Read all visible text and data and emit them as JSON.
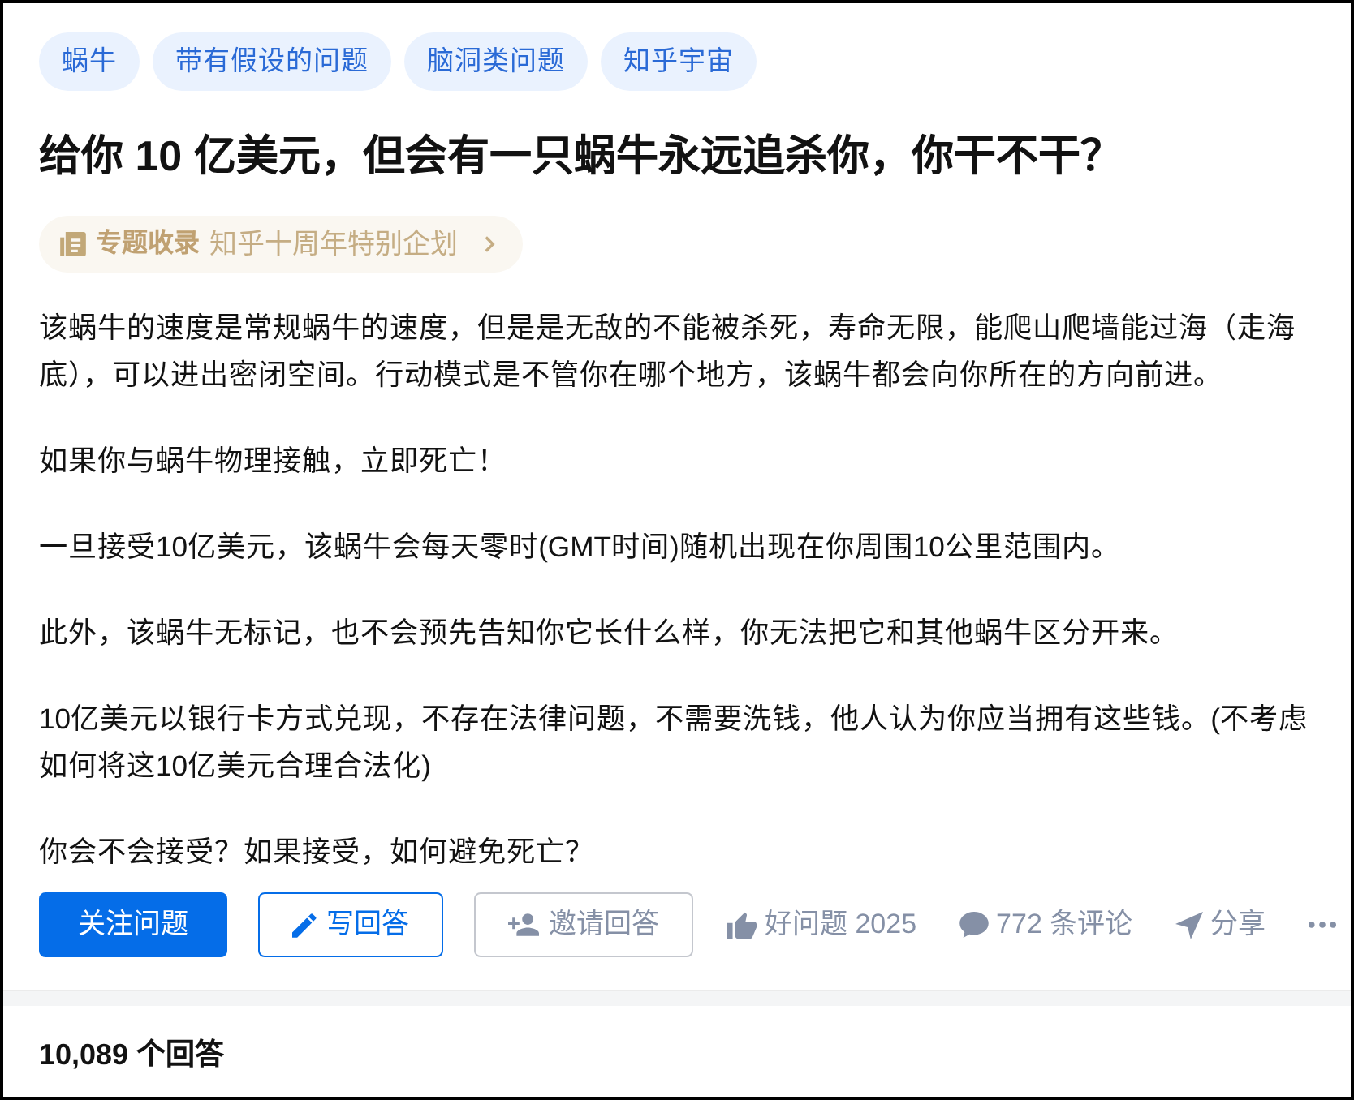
{
  "tags": [
    "蜗牛",
    "带有假设的问题",
    "脑洞类问题",
    "知乎宇宙"
  ],
  "title": "给你 10 亿美元，但会有一只蜗牛永远追杀你，你干不干？",
  "collection": {
    "label": "专题收录",
    "name": "知乎十周年特别企划"
  },
  "description": [
    "该蜗牛的速度是常规蜗牛的速度，但是是无敌的不能被杀死，寿命无限，能爬山爬墙能过海（走海底），可以进出密闭空间。行动模式是不管你在哪个地方，该蜗牛都会向你所在的方向前进。",
    "如果你与蜗牛物理接触，立即死亡！",
    "一旦接受10亿美元，该蜗牛会每天零时(GMT时间)随机出现在你周围10公里范围内。",
    "此外，该蜗牛无标记，也不会预先告知你它长什么样，你无法把它和其他蜗牛区分开来。",
    "10亿美元以银行卡方式兑现，不存在法律问题，不需要洗钱，他人认为你应当拥有这些钱。(不考虑如何将这10亿美元合理合法化)",
    "你会不会接受？如果接受，如何避免死亡？"
  ],
  "buttons": [
    {
      "label": "关注问题",
      "kind": "primary"
    },
    {
      "label": "写回答",
      "kind": "write"
    },
    {
      "label": "邀请回答",
      "kind": "invite"
    }
  ],
  "stats": [
    {
      "label": "好问题 2025",
      "kind": "like"
    },
    {
      "label": "772 条评论",
      "kind": "comment"
    },
    {
      "label": "分享",
      "kind": "share"
    },
    {
      "kind": "more"
    }
  ],
  "answer_count": "10,089 个回答"
}
